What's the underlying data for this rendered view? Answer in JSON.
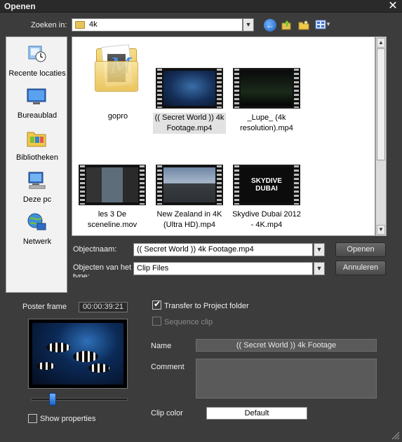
{
  "window": {
    "title": "Openen",
    "close_glyph": "✕"
  },
  "lookin": {
    "label": "Zoeken in:",
    "value": "4k",
    "icons": [
      "back-icon",
      "up-folder-icon",
      "new-folder-icon",
      "view-menu-icon"
    ]
  },
  "places": [
    {
      "label": "Recente locaties",
      "icon": "recent-places-icon"
    },
    {
      "label": "Bureaublad",
      "icon": "desktop-icon"
    },
    {
      "label": "Bibliotheken",
      "icon": "libraries-icon"
    },
    {
      "label": "Deze pc",
      "icon": "this-pc-icon"
    },
    {
      "label": "Netwerk",
      "icon": "network-icon"
    }
  ],
  "files": [
    {
      "name": "gopro",
      "type": "folder"
    },
    {
      "name": "(( Secret World )) 4k Footage.mp4",
      "type": "video",
      "selected": true
    },
    {
      "name": "_Lupe_ (4k resolution).mp4",
      "type": "video"
    },
    {
      "name": "les 3 De sceneline.mov",
      "type": "video"
    },
    {
      "name": "New Zealand in 4K (Ultra HD).mp4",
      "type": "video"
    },
    {
      "name": "Skydive Dubai 2012 - 4K.mp4",
      "type": "video"
    }
  ],
  "skydive_logo": {
    "line1": "SKYDIVE",
    "line2": "DUBAI"
  },
  "form": {
    "objectname_label": "Objectnaam:",
    "objectname_value": "(( Secret World )) 4k Footage.mp4",
    "filetype_label": "Objecten van het type:",
    "filetype_value": "Clip Files",
    "open_button": "Openen",
    "cancel_button": "Annuleren"
  },
  "poster": {
    "label": "Poster frame",
    "timecode": "00:00:39:21",
    "show_properties_label": "Show properties",
    "show_properties_checked": false
  },
  "options": {
    "transfer_label": "Transfer to Project folder",
    "transfer_checked": true,
    "sequence_label": "Sequence clip",
    "sequence_checked": false,
    "sequence_enabled": false
  },
  "details": {
    "name_label": "Name",
    "name_value": "(( Secret World )) 4k Footage",
    "comment_label": "Comment",
    "comment_value": "",
    "clipcolor_label": "Clip color",
    "clipcolor_value": "Default"
  },
  "colors": {
    "background": "#3c3c3c",
    "accent": "#1d5db8"
  }
}
